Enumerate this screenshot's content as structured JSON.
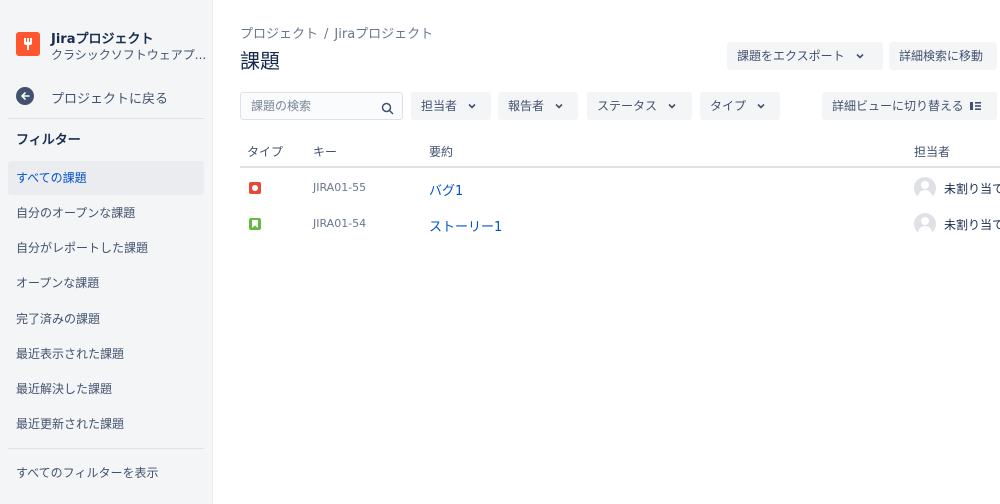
{
  "sidebar": {
    "project_name": "Jiraプロジェクト",
    "project_type": "クラシックソフトウェアプ...",
    "back_label": "プロジェクトに戻る",
    "filter_heading": "フィルター",
    "items": [
      {
        "label": "すべての課題",
        "active": true
      },
      {
        "label": "自分のオープンな課題"
      },
      {
        "label": "自分がレポートした課題"
      },
      {
        "label": "オープンな課題"
      },
      {
        "label": "完了済みの課題"
      },
      {
        "label": "最近表示された課題"
      },
      {
        "label": "最近解決した課題"
      },
      {
        "label": "最近更新された課題"
      }
    ],
    "view_all_filters": "すべてのフィルターを表示"
  },
  "breadcrumb": {
    "root": "プロジェクト",
    "separator": "/",
    "project": "Jiraプロジェクト"
  },
  "page": {
    "title": "課題",
    "export_label": "課題をエクスポート",
    "advanced_search_label": "詳細検索に移動"
  },
  "filters": {
    "search_placeholder": "課題の検索",
    "assignee": "担当者",
    "reporter": "報告者",
    "status": "ステータス",
    "type": "タイプ",
    "detail_view": "詳細ビューに切り替える"
  },
  "table": {
    "headers": {
      "type": "タイプ",
      "key": "キー",
      "summary": "要約",
      "assignee": "担当者"
    },
    "rows": [
      {
        "type": "bug-icon",
        "key": "JIRA01-55",
        "summary": "バグ1",
        "assignee": "未割り当て"
      },
      {
        "type": "story-icon",
        "key": "JIRA01-54",
        "summary": "ストーリー1",
        "assignee": "未割り当て"
      }
    ]
  },
  "colors": {
    "accent": "#0052cc",
    "sidebar_bg": "#f4f5f7",
    "bug": "#e5493a",
    "story": "#63ba3c",
    "project_logo": "#ff5630"
  }
}
